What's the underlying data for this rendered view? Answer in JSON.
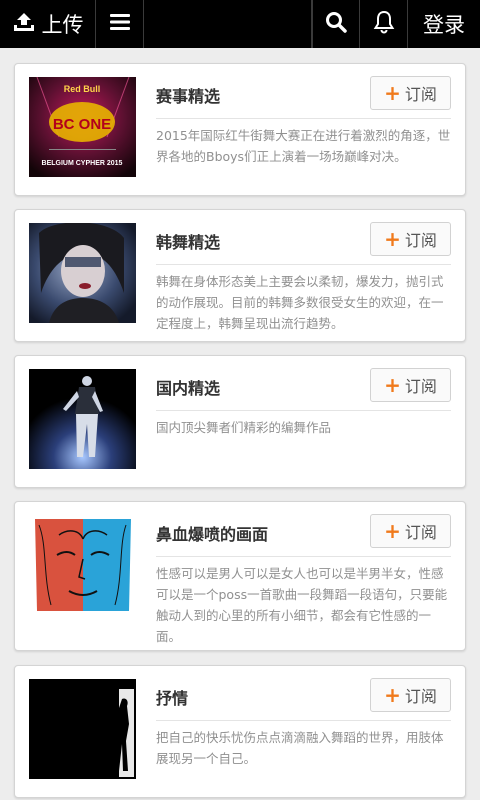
{
  "topbar": {
    "upload_label": "上传",
    "login_label": "登录"
  },
  "cards": [
    {
      "title": "赛事精选",
      "subscribe_label": "订阅",
      "description": "2015年国际红牛街舞大赛正在进行着激烈的角逐，世界各地的Bboys们正上演着一场场巅峰对决。",
      "thumb_text": {
        "brand": "Red Bull",
        "logo": "BC ONE",
        "caption": "BELGIUM CYPHER 2015"
      }
    },
    {
      "title": "韩舞精选",
      "subscribe_label": "订阅",
      "description": "韩舞在身体形态美上主要会以柔韧，爆发力，抛引式的动作展现。目前的韩舞多数很受女生的欢迎，在一定程度上，韩舞呈现出流行趋势。"
    },
    {
      "title": "国内精选",
      "subscribe_label": "订阅",
      "description": "国内顶尖舞者们精彩的编舞作品"
    },
    {
      "title": "鼻血爆喷的画面",
      "subscribe_label": "订阅",
      "description": "性感可以是男人可以是女人也可以是半男半女，性感可以是一个poss一首歌曲一段舞蹈一段语句，只要能触动人到的心里的所有小细节，都会有它性感的一面。"
    },
    {
      "title": "抒情",
      "subscribe_label": "订阅",
      "description": "把自己的快乐忧伤点点滴滴融入舞蹈的世界，用肢体展现另一个自己。"
    }
  ],
  "icons": {
    "upload": "upload-icon",
    "menu": "menu-icon",
    "search": "search-icon",
    "bell": "bell-icon",
    "plus": "plus-icon"
  },
  "colors": {
    "topbar_bg": "#000000",
    "page_bg": "#ededed",
    "accent": "#f07a1c",
    "title_text": "#333333",
    "desc_text": "#909090"
  }
}
